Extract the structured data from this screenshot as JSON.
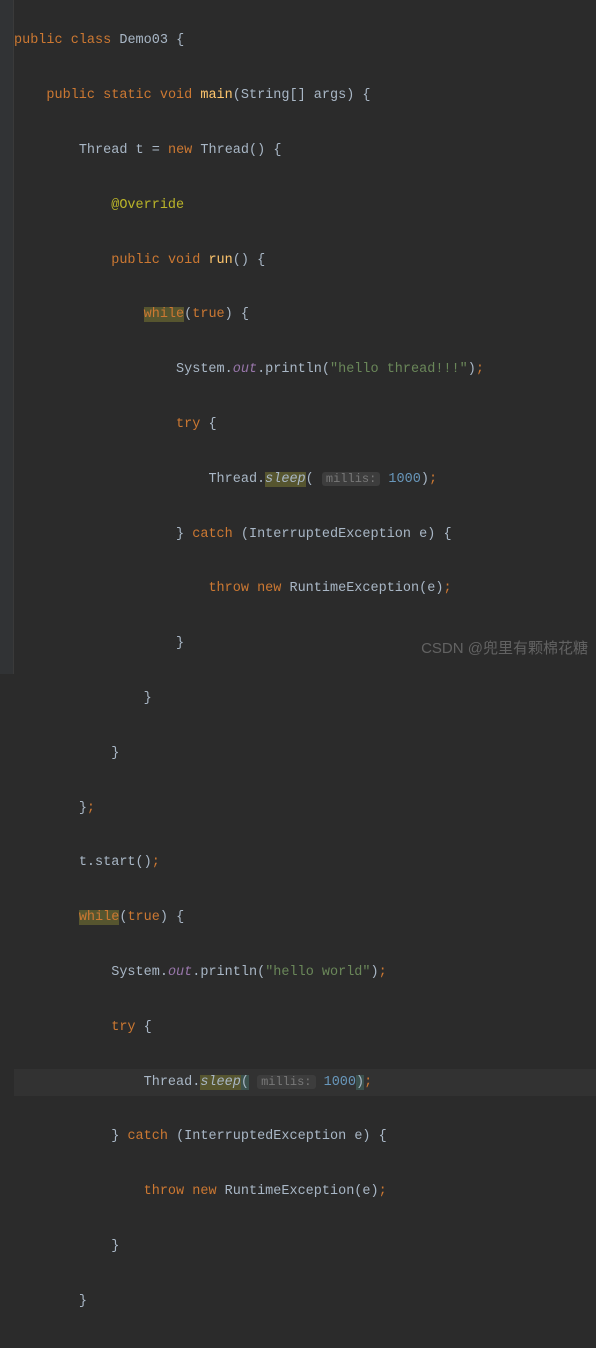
{
  "code": {
    "l1": {
      "public": "public",
      "class": "class",
      "name": "Demo03",
      "brace": "{"
    },
    "l2": {
      "public": "public",
      "static": "static",
      "void": "void",
      "main": "main",
      "params_open": "(",
      "type": "String",
      "brackets": "[]",
      "arg": "args",
      "params_close": ")",
      "brace": "{"
    },
    "l3": {
      "type": "Thread",
      "var": "t",
      "eq": "=",
      "new": "new",
      "ctor": "Thread",
      "parens": "()",
      "brace": "{"
    },
    "l4": {
      "anno": "@Override"
    },
    "l5": {
      "public": "public",
      "void": "void",
      "run": "run",
      "parens": "()",
      "brace": "{"
    },
    "l6": {
      "while": "while",
      "open": "(",
      "true": "true",
      "close": ")",
      "brace": "{"
    },
    "l7": {
      "sys": "System",
      "dot1": ".",
      "out": "out",
      "dot2": ".",
      "println": "println",
      "open": "(",
      "str": "\"hello thread!!!\"",
      "close": ")",
      "semi": ";"
    },
    "l8": {
      "try": "try",
      "brace": "{"
    },
    "l9": {
      "thread": "Thread",
      "dot": ".",
      "sleep": "sleep",
      "open": "(",
      "hint": "millis:",
      "val": "1000",
      "close": ")",
      "semi": ";"
    },
    "l10": {
      "close": "}",
      "catch": "catch",
      "open": "(",
      "ex": "InterruptedException",
      "var": "e",
      "close2": ")",
      "brace": "{"
    },
    "l11": {
      "throw": "throw",
      "new": "new",
      "ex": "RuntimeException",
      "open": "(",
      "arg": "e",
      "close": ")",
      "semi": ";"
    },
    "l12": {
      "close": "}"
    },
    "l13": {
      "close": "}"
    },
    "l14": {
      "close": "}"
    },
    "l15": {
      "close": "}",
      "semi": ";"
    },
    "l16": {
      "var": "t",
      "dot": ".",
      "start": "start",
      "parens": "()",
      "semi": ";"
    },
    "l17": {
      "while": "while",
      "open": "(",
      "true": "true",
      "close": ")",
      "brace": "{"
    },
    "l18": {
      "sys": "System",
      "dot1": ".",
      "out": "out",
      "dot2": ".",
      "println": "println",
      "open": "(",
      "str": "\"hello world\"",
      "close": ")",
      "semi": ";"
    },
    "l19": {
      "try": "try",
      "brace": "{"
    },
    "l20": {
      "thread": "Thread",
      "dot": ".",
      "sleep": "sleep",
      "open": "(",
      "hint": "millis:",
      "val": "1000",
      "close": ")",
      "semi": ";"
    },
    "l21": {
      "close": "}",
      "catch": "catch",
      "open": "(",
      "ex": "InterruptedException",
      "var": "e",
      "close2": ")",
      "brace": "{"
    },
    "l22": {
      "throw": "throw",
      "new": "new",
      "ex": "RuntimeException",
      "open": "(",
      "arg": "e",
      "close": ")",
      "semi": ";"
    },
    "l23": {
      "close": "}"
    },
    "l24": {
      "close": "}"
    }
  },
  "watermark": "CSDN @兜里有颗棉花糖"
}
